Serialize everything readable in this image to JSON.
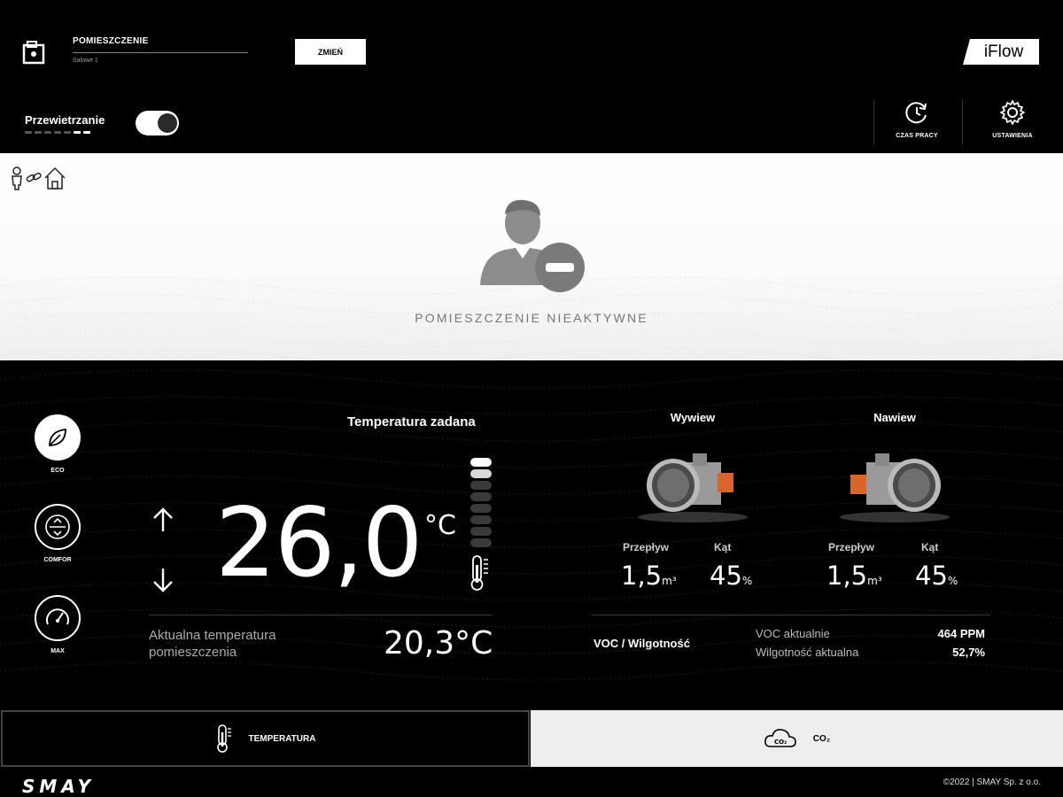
{
  "header": {
    "room_title": "POMIESZCZENIE",
    "room_subtitle": "Salowe 1",
    "change_button": "ZMIEŃ",
    "brand": "iFlow",
    "ventilation_label": "Przewietrzanie",
    "ventilation_on": true,
    "tools": [
      {
        "label": "CZAS PRACY",
        "icon": "clock-refresh-icon"
      },
      {
        "label": "USTAWIENIA",
        "icon": "gear-icon"
      }
    ]
  },
  "status": {
    "text": "POMIESZCZENIE NIEAKTYWNE",
    "icons": [
      "person-icon",
      "link-icon",
      "home-icon",
      "user-inactive-icon"
    ]
  },
  "modes": [
    {
      "label": "ECO",
      "icon": "leaf-icon",
      "active": true
    },
    {
      "label": "COMFOR",
      "icon": "comfort-icon",
      "active": false
    },
    {
      "label": "MAX",
      "icon": "speedometer-icon",
      "active": false
    }
  ],
  "temperature": {
    "set_title": "Temperatura zadana",
    "set_value": "26,0",
    "unit": "°C",
    "current_label_1": "Aktualna temperatura",
    "current_label_2": "pomieszczenia",
    "current_value": "20,3°C",
    "level_active": 2
  },
  "dampers": [
    {
      "title": "Wywiew",
      "flow_label": "Przepływ",
      "flow_value": "1,5",
      "flow_unit": "m³",
      "angle_label": "Kąt",
      "angle_value": "45",
      "angle_unit": "%"
    },
    {
      "title": "Nawiew",
      "flow_label": "Przepływ",
      "flow_value": "1,5",
      "flow_unit": "m³",
      "angle_label": "Kąt",
      "angle_value": "45",
      "angle_unit": "%"
    }
  ],
  "voc": {
    "title": "VOC / Wilgotność",
    "voc_label": "VOC aktualnie",
    "voc_value": "464 PPM",
    "humidity_label": "Wilgotność aktualna",
    "humidity_value": "52,7%"
  },
  "tabs": [
    {
      "label": "TEMPERATURA",
      "active": true,
      "icon": "thermometer-icon"
    },
    {
      "label": "CO₂",
      "active": false,
      "icon": "cloud-co2-icon"
    }
  ],
  "footer": {
    "logo": "SMAY",
    "copyright": "©2022 | SMAY Sp. z o.o."
  },
  "colors": {
    "accent": "#ffffff",
    "background": "#000000",
    "status_bg": "#ffffff",
    "damper_orange": "#d9652b"
  }
}
